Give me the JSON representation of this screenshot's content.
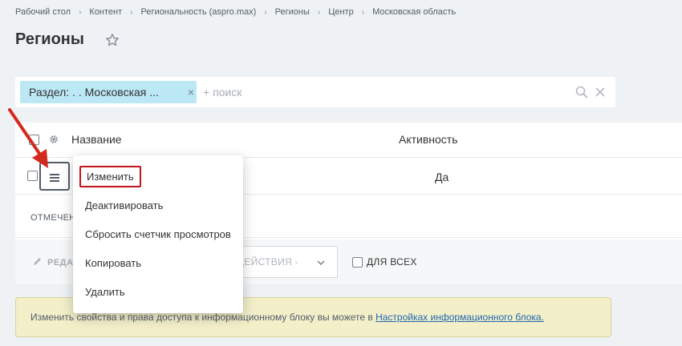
{
  "breadcrumbs": [
    "Рабочий стол",
    "Контент",
    "Региональность (aspro.max)",
    "Регионы",
    "Центр",
    "Московская область"
  ],
  "page": {
    "title": "Регионы"
  },
  "filter": {
    "chip_label": "Раздел: . . Московская ...",
    "search_placeholder": "+ поиск"
  },
  "grid": {
    "columns": {
      "name": "Название",
      "active": "Активность"
    },
    "row": {
      "active": "Да"
    },
    "marked_label": "отмечен"
  },
  "actions": {
    "edit_label": "РЕДА",
    "select_label": "- ДЕЙСТВИЯ -",
    "for_all_label": "ДЛЯ ВСЕХ"
  },
  "context_menu": {
    "items": [
      "Изменить",
      "Деактивировать",
      "Сбросить счетчик просмотров",
      "Копировать",
      "Удалить"
    ]
  },
  "info": {
    "text": "Изменить свойства и права доступа к информационному блоку вы можете в ",
    "link": "Настройках информационного блока."
  },
  "colors": {
    "background": "#eef2f4",
    "chip": "#bce8f5",
    "highlight": "#c0151b",
    "arrow": "#d42a1e",
    "info_bg": "#f2efc9",
    "link": "#2067b0"
  }
}
